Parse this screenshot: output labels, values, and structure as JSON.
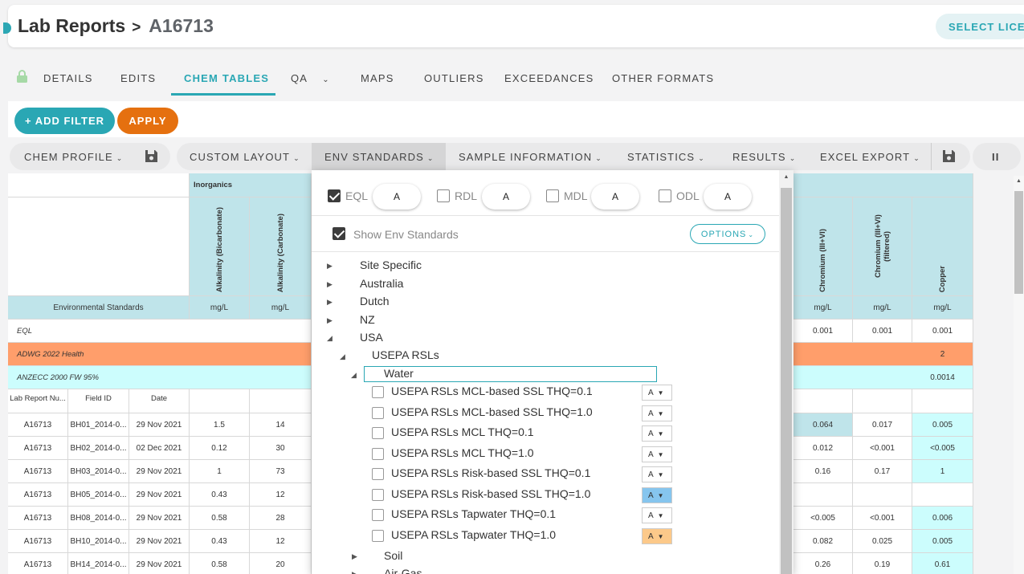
{
  "header": {
    "title": "Lab Reports",
    "separator": ">",
    "report_id": "A16713",
    "license_button": "SELECT LICEN"
  },
  "tabs": [
    {
      "label": "DETAILS"
    },
    {
      "label": "EDITS"
    },
    {
      "label": "CHEM TABLES",
      "active": true
    },
    {
      "label": "QA"
    },
    {
      "label": "MAPS"
    },
    {
      "label": "OUTLIERS"
    },
    {
      "label": "EXCEEDANCES"
    },
    {
      "label": "OTHER FORMATS"
    }
  ],
  "filters": {
    "add_filter": "+ ADD FILTER",
    "apply": "APPLY"
  },
  "toolbar": {
    "chem_profile": "CHEM PROFILE",
    "custom_layout": "CUSTOM LAYOUT",
    "env_standards": "ENV STANDARDS",
    "sample_information": "SAMPLE INFORMATION",
    "statistics": "STATISTICS",
    "results": "RESULTS",
    "excel_export": "EXCEL EXPORT",
    "pause": "II"
  },
  "grid": {
    "group_header": "Inorganics",
    "env_standards_label": "Environmental Standards",
    "columns_left": [
      {
        "name": "Alkalinity (Bicarbonate)",
        "unit": "mg/L"
      },
      {
        "name": "Alkalinity (Carbonate)",
        "unit": "mg/L"
      }
    ],
    "columns_right": [
      {
        "name": "Chromium (III+VI)",
        "unit": "mg/L",
        "eql": "0.001"
      },
      {
        "name": "Chromium (III+VI) (filtered)",
        "unit": "mg/L",
        "eql": "0.001"
      },
      {
        "name": "Copper",
        "unit": "mg/L",
        "eql": "0.001",
        "adwg": "2",
        "anzecc": "0.0014"
      }
    ],
    "std_rows": [
      "EQL",
      "ADWG 2022 Health",
      "ANZECC 2000 FW 95%"
    ],
    "id_headers": [
      "Lab Report Nu...",
      "Field ID",
      "Date"
    ],
    "rows": [
      {
        "lab": "A16713",
        "field": "BH01_2014-0...",
        "date": "29 Nov 2021",
        "a": "1.5",
        "b": "14",
        "cr": "0.064",
        "crf": "0.017",
        "cu": "0.005"
      },
      {
        "lab": "A16713",
        "field": "BH02_2014-0...",
        "date": "02 Dec 2021",
        "a": "0.12",
        "b": "30",
        "cr": "0.012",
        "crf": "<0.001",
        "cu": "<0.005"
      },
      {
        "lab": "A16713",
        "field": "BH03_2014-0...",
        "date": "29 Nov 2021",
        "a": "1",
        "b": "73",
        "cr": "0.16",
        "crf": "0.17",
        "cu": "1"
      },
      {
        "lab": "A16713",
        "field": "BH05_2014-0...",
        "date": "29 Nov 2021",
        "a": "0.43",
        "b": "12",
        "cr": "",
        "crf": "",
        "cu": ""
      },
      {
        "lab": "A16713",
        "field": "BH08_2014-0...",
        "date": "29 Nov 2021",
        "a": "0.58",
        "b": "28",
        "cr": "<0.005",
        "crf": "<0.001",
        "cu": "0.006"
      },
      {
        "lab": "A16713",
        "field": "BH10_2014-0...",
        "date": "29 Nov 2021",
        "a": "0.43",
        "b": "12",
        "cr": "0.082",
        "crf": "0.025",
        "cu": "0.005"
      },
      {
        "lab": "A16713",
        "field": "BH14_2014-0...",
        "date": "29 Nov 2021",
        "a": "0.58",
        "b": "20",
        "cr": "0.26",
        "crf": "0.19",
        "cu": "0.61"
      }
    ]
  },
  "dropdown": {
    "limits": [
      {
        "label": "EQL",
        "checked": true,
        "value": "A"
      },
      {
        "label": "RDL",
        "checked": false,
        "value": "A"
      },
      {
        "label": "MDL",
        "checked": false,
        "value": "A"
      },
      {
        "label": "ODL",
        "checked": false,
        "value": "A"
      }
    ],
    "show_env_standards": "Show Env Standards",
    "options_button": "OPTIONS",
    "tree_top": [
      "Site Specific",
      "Australia",
      "Dutch",
      "NZ",
      "USA"
    ],
    "usepa": "USEPA RSLs",
    "water": "Water",
    "standards": [
      {
        "label": "USEPA RSLs MCL-based SSL THQ=0.1",
        "value": "A",
        "color": ""
      },
      {
        "label": "USEPA RSLs MCL-based SSL THQ=1.0",
        "value": "A",
        "color": ""
      },
      {
        "label": "USEPA RSLs MCL THQ=0.1",
        "value": "A",
        "color": ""
      },
      {
        "label": "USEPA RSLs MCL THQ=1.0",
        "value": "A",
        "color": ""
      },
      {
        "label": "USEPA RSLs Risk-based SSL THQ=0.1",
        "value": "A",
        "color": ""
      },
      {
        "label": "USEPA RSLs Risk-based SSL THQ=1.0",
        "value": "A",
        "color": "#86c5ee"
      },
      {
        "label": "USEPA RSLs Tapwater THQ=0.1",
        "value": "A",
        "color": ""
      },
      {
        "label": "USEPA RSLs Tapwater THQ=1.0",
        "value": "A",
        "color": "#fcc98a"
      }
    ],
    "soil": "Soil",
    "air_gas": "Air-Gas"
  },
  "colors": {
    "accent": "#2aa7b4",
    "apply": "#e5700f",
    "adwg_row": "#ff9e6b",
    "anzecc_row": "#ccfdfd",
    "header_bg": "#bfe4ea"
  }
}
